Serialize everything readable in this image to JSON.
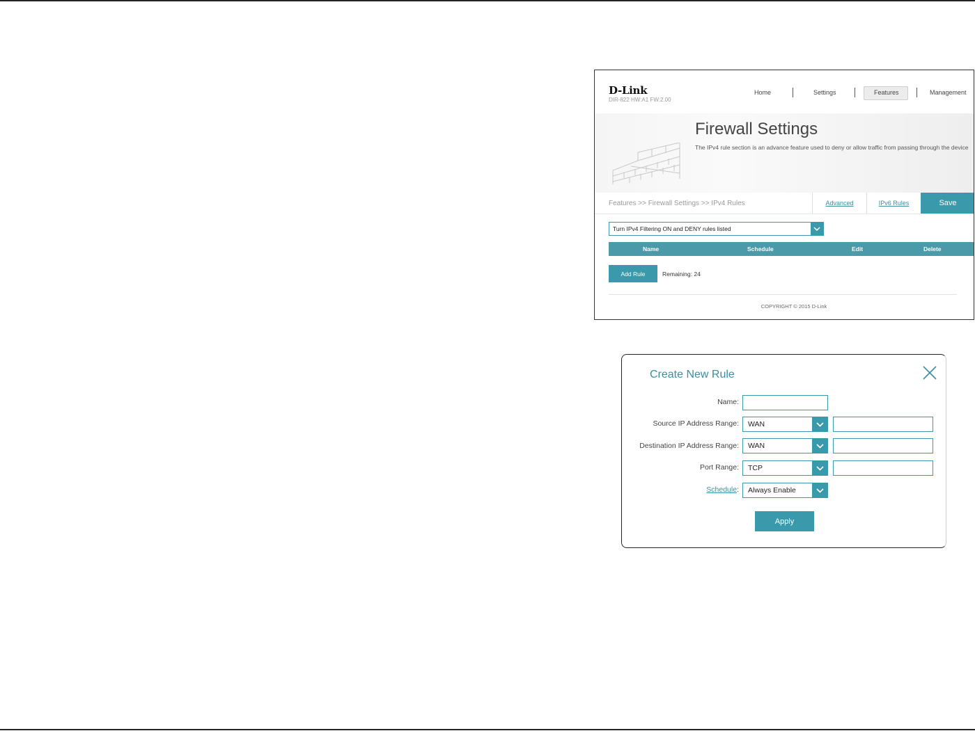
{
  "firewall_page": {
    "brand": "D-Link",
    "model": "DIR-822 HW:A1 FW:2.00",
    "nav": [
      "Home",
      "Settings",
      "Features",
      "Management"
    ],
    "active_nav": "Features",
    "title": "Firewall Settings",
    "description": "The IPv4 rule section is an advance feature used to deny or allow traffic from passing through the device",
    "breadcrumb": "Features >> Firewall Settings >> IPv4 Rules",
    "tabs": {
      "advanced": "Advanced",
      "ipv6": "IPv6 Rules"
    },
    "save_label": "Save",
    "filter_value": "Turn IPv4 Filtering ON and DENY rules listed",
    "table_headers": [
      "Name",
      "Schedule",
      "Edit",
      "Delete"
    ],
    "add_rule_label": "Add Rule",
    "remaining": "Remaining: 24",
    "copyright": "COPYRIGHT © 2015 D-Link"
  },
  "dialog": {
    "title": "Create New Rule",
    "name_label": "Name:",
    "name_value": "",
    "source_label": "Source IP Address Range:",
    "source_value": "WAN",
    "source_ip": "",
    "dest_label": "Destination IP Address Range:",
    "dest_value": "WAN",
    "dest_ip": "",
    "port_label": "Port Range:",
    "port_value": "TCP",
    "port_range": "",
    "schedule_label": "Schedule",
    "schedule_colon": ":",
    "schedule_value": "Always Enable",
    "apply_label": "Apply"
  },
  "colors": {
    "accent": "#3a9aab",
    "accent_text": "#3a8ea0"
  },
  "icons": {
    "close": "close-icon",
    "dropdown": "chevron-down-icon",
    "banner": "brick-wall-icon"
  }
}
